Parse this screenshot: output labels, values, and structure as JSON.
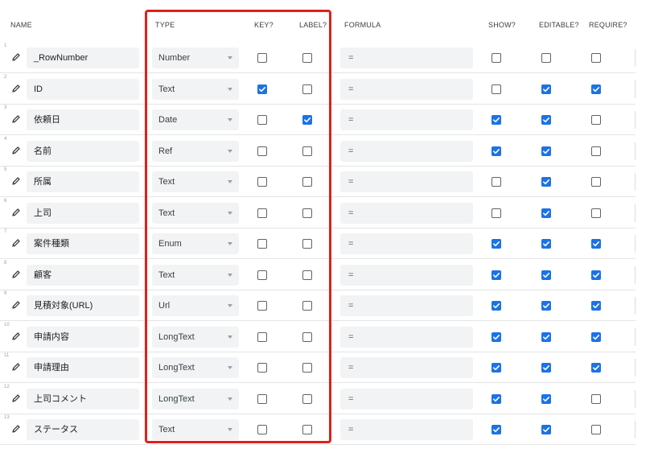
{
  "headers": {
    "name": "NAME",
    "type": "TYPE",
    "key": "KEY?",
    "label": "LABEL?",
    "formula": "FORMULA",
    "show": "SHOW?",
    "editable": "EDITABLE?",
    "require": "REQUIRE?"
  },
  "highlight_color": "#e0201b",
  "checkbox_checked_color": "#1a73e8",
  "rows": [
    {
      "num": "1",
      "name": "_RowNumber",
      "type": "Number",
      "formula": "=",
      "key": false,
      "label": false,
      "show": false,
      "editable": false,
      "require": false
    },
    {
      "num": "2",
      "name": "ID",
      "type": "Text",
      "formula": "=",
      "key": true,
      "label": false,
      "show": false,
      "editable": true,
      "require": true
    },
    {
      "num": "3",
      "name": "依頼日",
      "type": "Date",
      "formula": "=",
      "key": false,
      "label": true,
      "show": true,
      "editable": true,
      "require": false
    },
    {
      "num": "4",
      "name": "名前",
      "type": "Ref",
      "formula": "=",
      "key": false,
      "label": false,
      "show": true,
      "editable": true,
      "require": false
    },
    {
      "num": "5",
      "name": "所属",
      "type": "Text",
      "formula": "=",
      "key": false,
      "label": false,
      "show": false,
      "editable": true,
      "require": false
    },
    {
      "num": "6",
      "name": "上司",
      "type": "Text",
      "formula": "=",
      "key": false,
      "label": false,
      "show": false,
      "editable": true,
      "require": false
    },
    {
      "num": "7",
      "name": "案件種類",
      "type": "Enum",
      "formula": "=",
      "key": false,
      "label": false,
      "show": true,
      "editable": true,
      "require": true
    },
    {
      "num": "8",
      "name": "顧客",
      "type": "Text",
      "formula": "=",
      "key": false,
      "label": false,
      "show": true,
      "editable": true,
      "require": true
    },
    {
      "num": "9",
      "name": "見積対象(URL)",
      "type": "Url",
      "formula": "=",
      "key": false,
      "label": false,
      "show": true,
      "editable": true,
      "require": true
    },
    {
      "num": "10",
      "name": "申請内容",
      "type": "LongText",
      "formula": "=",
      "key": false,
      "label": false,
      "show": true,
      "editable": true,
      "require": true
    },
    {
      "num": "11",
      "name": "申請理由",
      "type": "LongText",
      "formula": "=",
      "key": false,
      "label": false,
      "show": true,
      "editable": true,
      "require": true
    },
    {
      "num": "12",
      "name": "上司コメント",
      "type": "LongText",
      "formula": "=",
      "key": false,
      "label": false,
      "show": true,
      "editable": true,
      "require": false
    },
    {
      "num": "13",
      "name": "ステータス",
      "type": "Text",
      "formula": "=",
      "key": false,
      "label": false,
      "show": true,
      "editable": true,
      "require": false
    }
  ]
}
